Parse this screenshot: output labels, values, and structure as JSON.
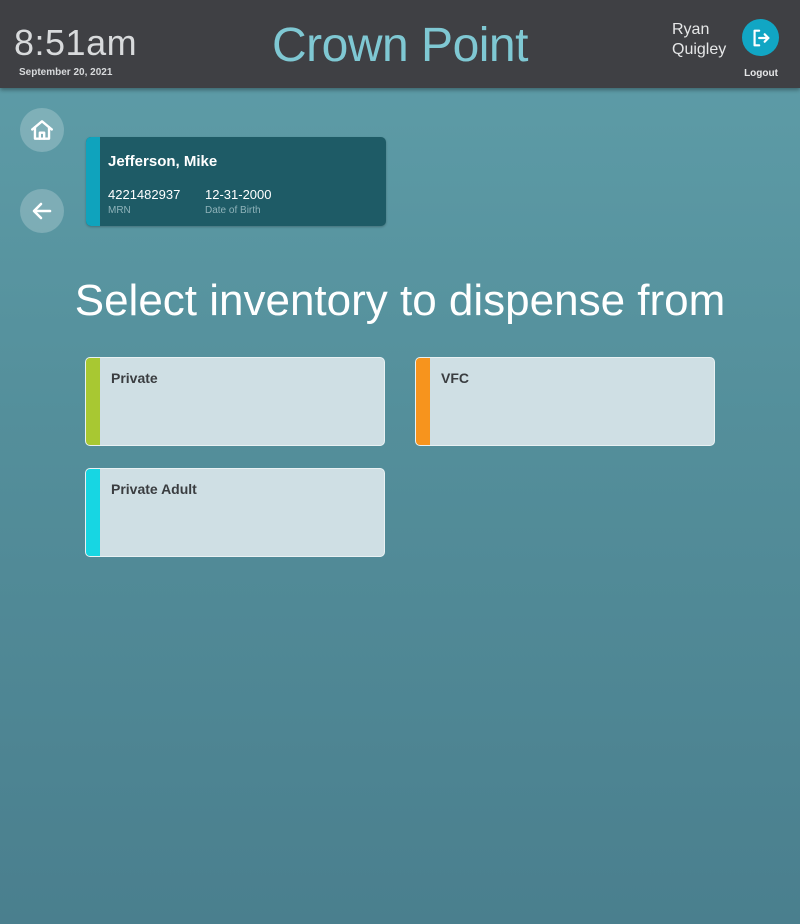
{
  "header": {
    "time": "8:51am",
    "date": "September 20, 2021",
    "site_title": "Crown Point",
    "user_first": "Ryan",
    "user_last": "Quigley",
    "logout_label": "Logout"
  },
  "nav": {
    "home_icon": "home-icon",
    "back_icon": "arrow-left-icon"
  },
  "patient": {
    "name": "Jefferson, Mike",
    "mrn": "4221482937",
    "mrn_label": "MRN",
    "dob": "12-31-2000",
    "dob_label": "Date of Birth",
    "accent": "#0fa3bd"
  },
  "main": {
    "heading": "Select inventory to dispense from"
  },
  "inventories": [
    {
      "label": "Private",
      "color": "#a8c832"
    },
    {
      "label": "VFC",
      "color": "#f7941d"
    },
    {
      "label": "Private Adult",
      "color": "#17d6e3"
    }
  ]
}
